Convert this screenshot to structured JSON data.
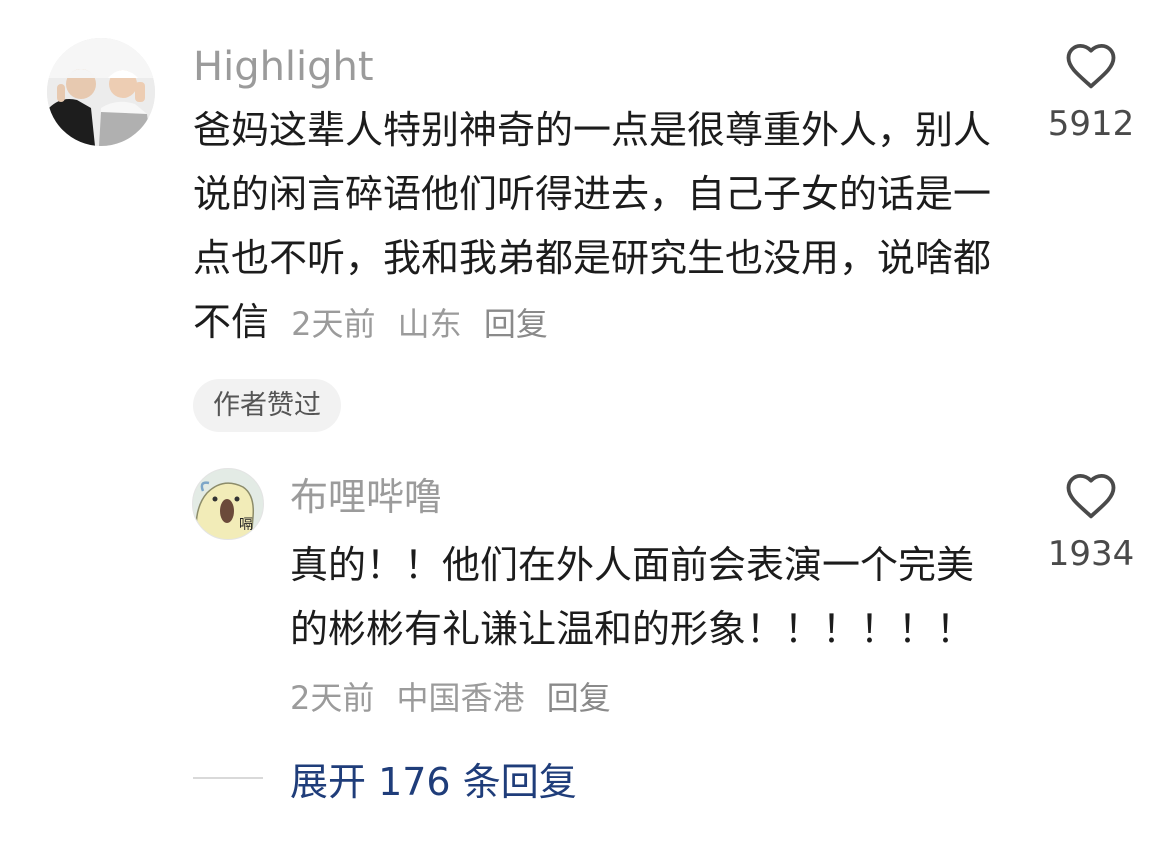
{
  "comment": {
    "username": "Highlight",
    "text": "爸妈这辈人特别神奇的一点是很尊重外人，别人说的闲言碎语他们听得进去，自己子女的话是一点也不听，我和我弟都是研究生也没用，说啥都不信",
    "time": "2天前",
    "location": "山东",
    "reply_label": "回复",
    "badge": "作者赞过",
    "likes": "5912"
  },
  "reply": {
    "username": "布哩哔噜",
    "text": "真的！！他们在外人面前会表演一个完美的彬彬有礼谦让温和的形象！！！！！！",
    "time": "2天前",
    "location": "中国香港",
    "reply_label": "回复",
    "likes": "1934",
    "avatar_text": "嗝"
  },
  "expand": {
    "label": "展开 176 条回复"
  },
  "colors": {
    "meta_gray": "#9b9b9b",
    "link_blue": "#1f3d7a",
    "badge_bg": "#f2f2f2"
  },
  "icons": {
    "like": "heart-outline-icon"
  }
}
